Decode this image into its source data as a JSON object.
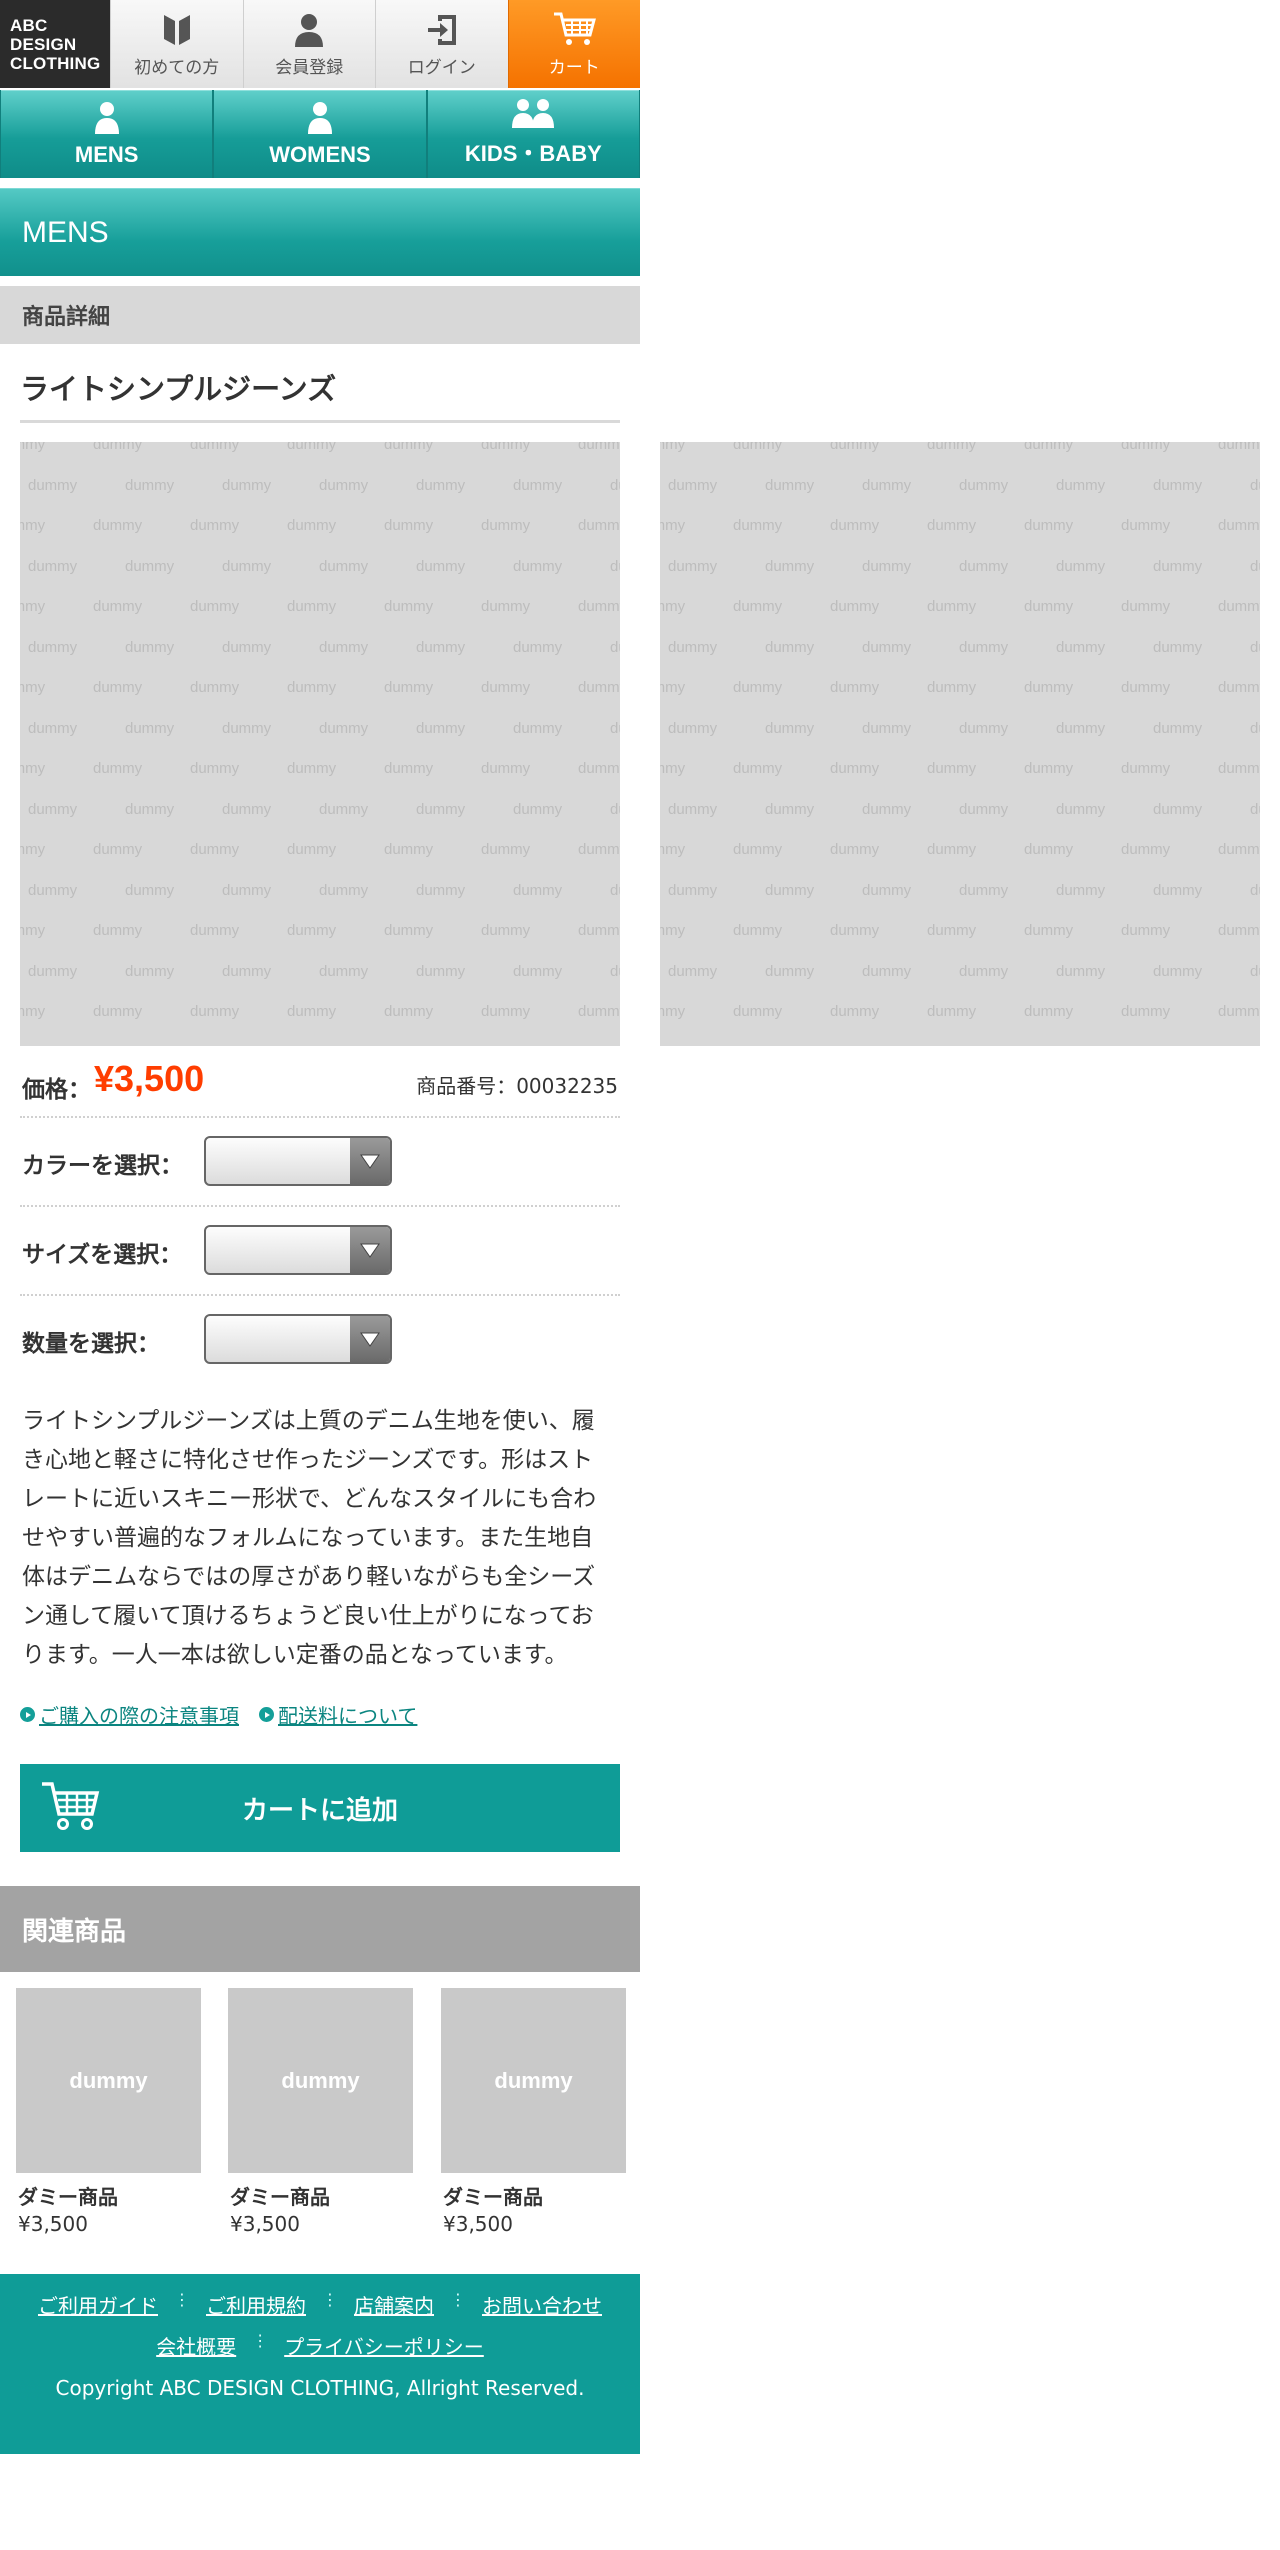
{
  "header": {
    "logo": [
      "ABC",
      "DESIGN",
      "CLOTHING"
    ],
    "nav": [
      {
        "label": "初めての方",
        "icon": "book-icon"
      },
      {
        "label": "会員登録",
        "icon": "user-icon"
      },
      {
        "label": "ログイン",
        "icon": "login-icon"
      },
      {
        "label": "カート",
        "icon": "cart-icon"
      }
    ],
    "cart_color": "#f57200"
  },
  "categories": [
    {
      "label": "MENS",
      "icon": "person-icon"
    },
    {
      "label": "WOMENS",
      "icon": "person-icon"
    },
    {
      "label": "KIDS・BABY",
      "icon": "people-icon"
    }
  ],
  "section_title": "MENS",
  "breadcrumb": "商品詳細",
  "product": {
    "title": "ライトシンプルジーンズ",
    "image_placeholder": "dummy",
    "price_label": "価格：",
    "price": "¥3,500",
    "sku_label": "商品番号：",
    "sku": "00032235",
    "options": [
      {
        "label": "カラーを選択："
      },
      {
        "label": "サイズを選択："
      },
      {
        "label": "数量を選択："
      }
    ],
    "description": "ライトシンプルジーンズは上質のデニム生地を使い、履き心地と軽さに特化させ作ったジーンズです。形はストレートに近いスキニー形状で、どんなスタイルにも合わせやすい普遍的なフォルムになっています。また生地自体はデニムならではの厚さがあり軽いながらも全シーズン通して履いて頂けるちょうど良い仕上がりになっております。一人一本は欲しい定番の品となっています。",
    "links": [
      "ご購入の際の注意事項",
      "配送料について"
    ],
    "add_to_cart": "カートに追加"
  },
  "related": {
    "title": "関連商品",
    "items": [
      {
        "thumb": "dummy",
        "name": "ダミー商品",
        "price": "¥3,500"
      },
      {
        "thumb": "dummy",
        "name": "ダミー商品",
        "price": "¥3,500"
      },
      {
        "thumb": "dummy",
        "name": "ダミー商品",
        "price": "¥3,500"
      }
    ]
  },
  "footer": {
    "links_row1": [
      "ご利用ガイド",
      "ご利用規約",
      "店舗案内",
      "お問い合わせ"
    ],
    "links_row2": [
      "会社概要",
      "プライバシーポリシー"
    ],
    "copyright": "Copyright ABC DESIGN CLOTHING, Allright Reserved."
  },
  "colors": {
    "teal": "#0f9c97",
    "price": "#ff3d00",
    "orange": "#f57200"
  }
}
